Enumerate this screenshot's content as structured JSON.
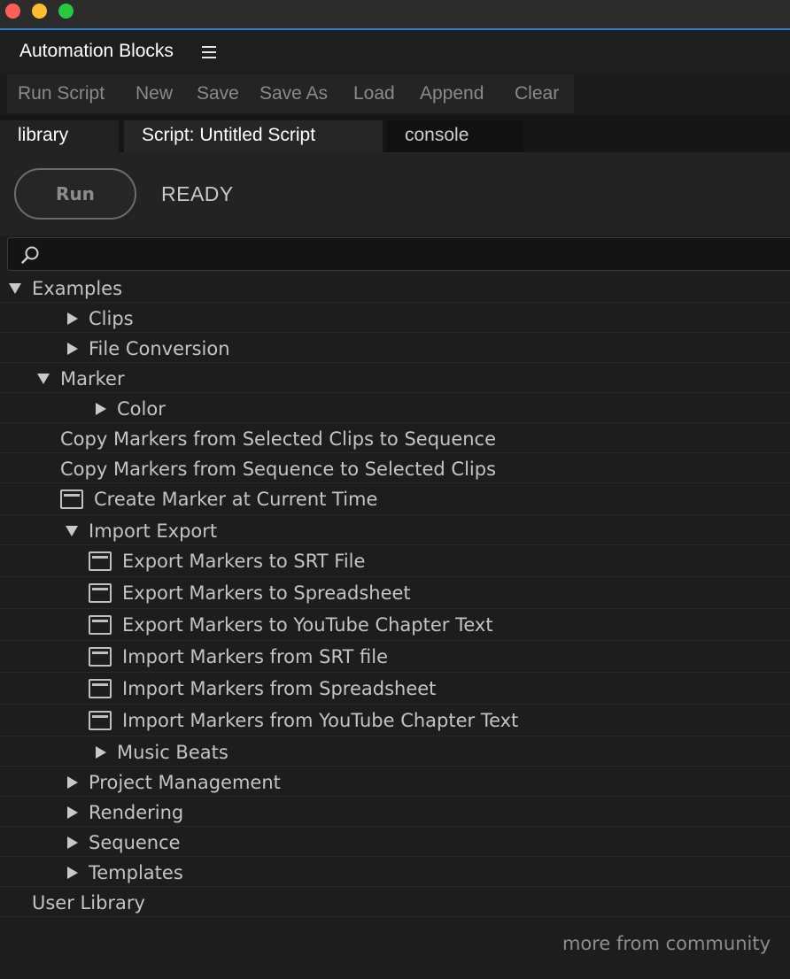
{
  "panel": {
    "title": "Automation Blocks"
  },
  "menu": {
    "items": [
      "Run Script",
      "New",
      "Save",
      "Save As",
      "Load",
      "Append",
      "Clear"
    ]
  },
  "tabs": {
    "library": "library",
    "script": "Script: Untitled Script",
    "console": "console"
  },
  "run": {
    "button_label": "Run",
    "status": "READY"
  },
  "search": {
    "value": "",
    "placeholder": ""
  },
  "tree": [
    {
      "label": "Examples",
      "level": 0,
      "state": "expanded"
    },
    {
      "label": "Clips",
      "level": 1,
      "state": "collapsed"
    },
    {
      "label": "File Conversion",
      "level": 1,
      "state": "collapsed"
    },
    {
      "label": "Marker",
      "level": 1,
      "state": "expanded"
    },
    {
      "label": "Color",
      "level": 2,
      "state": "collapsed"
    },
    {
      "label": "Copy Markers from Selected Clips to Sequence",
      "level": 2,
      "state": "leaf"
    },
    {
      "label": "Copy Markers from Sequence to Selected Clips",
      "level": 2,
      "state": "leaf"
    },
    {
      "label": "Create Marker at Current Time",
      "level": 2,
      "state": "script"
    },
    {
      "label": "Import Export",
      "level": 2,
      "state": "expanded"
    },
    {
      "label": "Export Markers to SRT File",
      "level": 3,
      "state": "script"
    },
    {
      "label": "Export Markers to Spreadsheet",
      "level": 3,
      "state": "script"
    },
    {
      "label": "Export Markers to YouTube Chapter Text",
      "level": 3,
      "state": "script"
    },
    {
      "label": "Import Markers from SRT file",
      "level": 3,
      "state": "script"
    },
    {
      "label": "Import Markers from Spreadsheet",
      "level": 3,
      "state": "script"
    },
    {
      "label": "Import Markers from YouTube Chapter Text",
      "level": 3,
      "state": "script"
    },
    {
      "label": "Music Beats",
      "level": 2,
      "state": "collapsed"
    },
    {
      "label": "Project Management",
      "level": 1,
      "state": "collapsed"
    },
    {
      "label": "Rendering",
      "level": 1,
      "state": "collapsed"
    },
    {
      "label": "Sequence",
      "level": 1,
      "state": "collapsed"
    },
    {
      "label": "Templates",
      "level": 1,
      "state": "collapsed"
    },
    {
      "label": "User Library",
      "level": 0,
      "state": "leaf"
    }
  ],
  "footer": {
    "link": "more from community"
  },
  "colors": {
    "accent": "#2c81d4",
    "background": "#1d1d1d",
    "text": "#c4c4c4"
  }
}
